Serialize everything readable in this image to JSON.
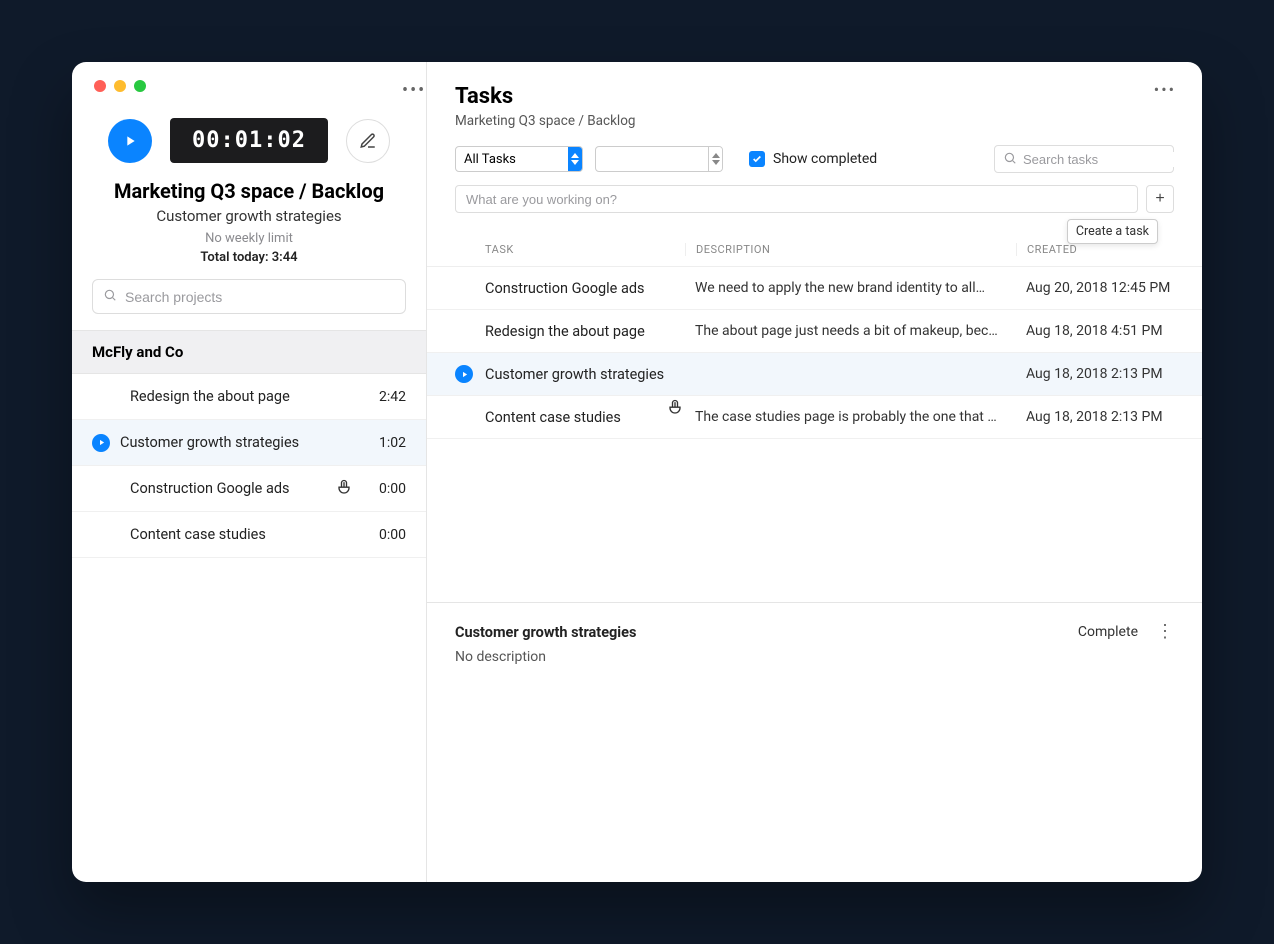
{
  "timer": {
    "elapsed": "00:01:02"
  },
  "header": {
    "project_path": "Marketing Q3 space / Backlog",
    "current_task": "Customer growth strategies",
    "limit_text": "No weekly limit",
    "total_today": "Total today: 3:44"
  },
  "sidebar": {
    "search_placeholder": "Search projects",
    "workspace_name": "McFly and Co",
    "items": [
      {
        "name": "Redesign the about page",
        "time": "2:42",
        "active": false
      },
      {
        "name": "Customer growth strategies",
        "time": "1:02",
        "active": true
      },
      {
        "name": "Construction Google ads",
        "time": "0:00",
        "active": false
      },
      {
        "name": "Content case studies",
        "time": "0:00",
        "active": false
      }
    ]
  },
  "main": {
    "title": "Tasks",
    "breadcrumb": "Marketing Q3 space / Backlog",
    "filter_select": "All Tasks",
    "show_completed_label": "Show completed",
    "search_placeholder": "Search tasks",
    "new_task_placeholder": "What are you working on?",
    "create_tooltip": "Create a task",
    "columns": {
      "task": "TASK",
      "description": "DESCRIPTION",
      "created": "CREATED"
    },
    "rows": [
      {
        "name": "Construction Google ads",
        "description": "We need to apply the new brand identity to all…",
        "created": "Aug 20, 2018 12:45 PM",
        "selected": false
      },
      {
        "name": "Redesign the about page",
        "description": "The about page just needs a bit of makeup, bec…",
        "created": "Aug 18, 2018 4:51 PM",
        "selected": false
      },
      {
        "name": "Customer growth strategies",
        "description": "",
        "created": "Aug 18, 2018 2:13 PM",
        "selected": true
      },
      {
        "name": "Content case studies",
        "description": "The case studies page is probably the one that …",
        "created": "Aug 18, 2018 2:13 PM",
        "selected": false
      }
    ]
  },
  "detail": {
    "title": "Customer growth strategies",
    "description": "No description",
    "complete_label": "Complete"
  }
}
